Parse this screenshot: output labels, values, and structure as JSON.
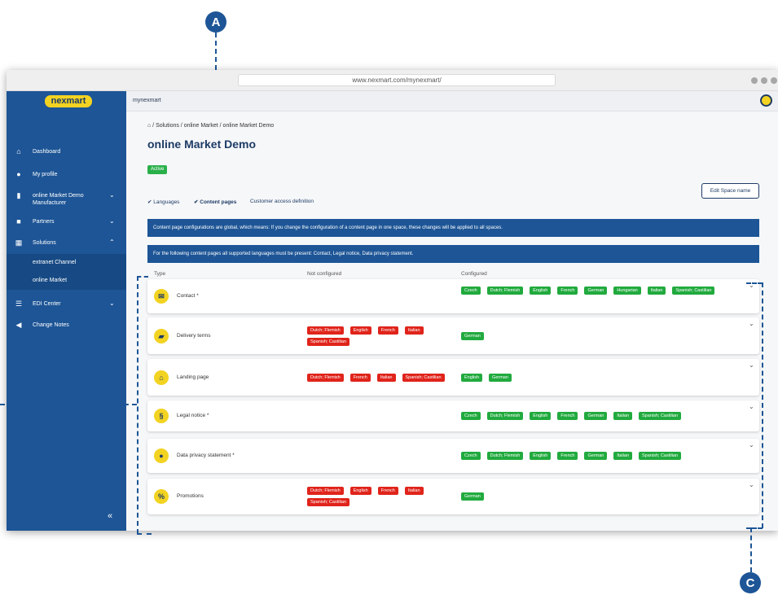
{
  "callouts": {
    "a": "A",
    "c": "C"
  },
  "browser": {
    "url": "www.nexmart.com/mynexmart/"
  },
  "brand": {
    "logo_text": "nexmart"
  },
  "header": {
    "title": "mynexmart"
  },
  "sidebar": {
    "items": [
      {
        "label": "Dashboard",
        "icon": "home-icon"
      },
      {
        "label": "My profile",
        "icon": "user-icon"
      },
      {
        "label": "online Market Demo Manufacturer",
        "icon": "building-icon"
      },
      {
        "label": "Partners",
        "icon": "briefcase-icon"
      },
      {
        "label": "Solutions",
        "icon": "grid-icon"
      },
      {
        "label": "EDI Center",
        "icon": "list-icon"
      },
      {
        "label": "Change Notes",
        "icon": "megaphone-icon"
      }
    ],
    "subitems": [
      "extranet Channel",
      "online Market"
    ],
    "collapse_label": "«"
  },
  "breadcrumb": "⌂ / Solutions / online Market / online Market Demo",
  "page": {
    "title": "online Market Demo",
    "status": "Active",
    "edit_button": "Edit Space name"
  },
  "tabs": [
    "Languages",
    "Content pages",
    "Customer access definition"
  ],
  "banners": [
    "Content page configurations are global, which means: If you change the configuration of a content page in one space, these changes will be applied to all spaces.",
    "For the following content pages all supported languages must be present: Contact, Legal notice, Data privacy statement."
  ],
  "columns": [
    "Type",
    "Not configured",
    "Configured"
  ],
  "rows": [
    {
      "name": "Contact *",
      "icon": "envelope-icon",
      "not_configured": [],
      "configured": [
        "Czech",
        "Dutch; Flemish",
        "English",
        "French",
        "German",
        "Hungarian",
        "Italian",
        "Spanish; Castilian"
      ]
    },
    {
      "name": "Delivery terms",
      "icon": "truck-icon",
      "not_configured": [
        "Dutch; Flemish",
        "English",
        "French",
        "Italian",
        "Spanish; Castilian"
      ],
      "configured": [
        "German"
      ]
    },
    {
      "name": "Landing page",
      "icon": "home-icon",
      "not_configured": [
        "Dutch; Flemish",
        "French",
        "Italian",
        "Spanish; Castilian"
      ],
      "configured": [
        "English",
        "German"
      ]
    },
    {
      "name": "Legal notice *",
      "icon": "paragraph-icon",
      "not_configured": [],
      "configured": [
        "Czech",
        "Dutch; Flemish",
        "English",
        "French",
        "German",
        "Italian",
        "Spanish; Castilian"
      ]
    },
    {
      "name": "Data privacy statement *",
      "icon": "users-icon",
      "not_configured": [],
      "configured": [
        "Czech",
        "Dutch; Flemish",
        "English",
        "French",
        "German",
        "Italian",
        "Spanish; Castilian"
      ]
    },
    {
      "name": "Promotions",
      "icon": "percent-icon",
      "not_configured": [
        "Dutch; Flemish",
        "English",
        "French",
        "Italian",
        "Spanish; Castilian"
      ],
      "configured": [
        "German"
      ]
    }
  ]
}
